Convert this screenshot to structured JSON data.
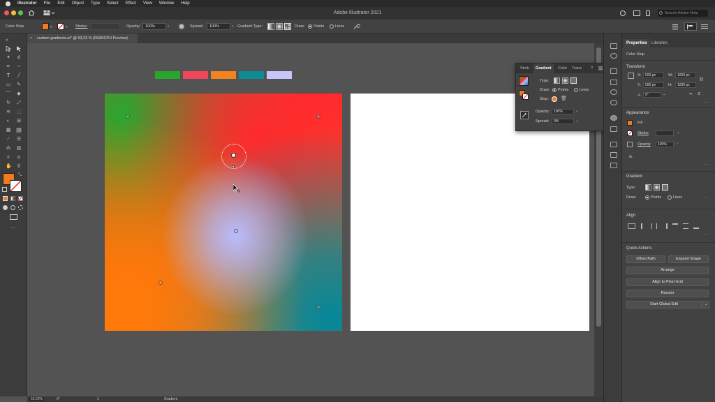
{
  "menubar": {
    "app": "Illustrator",
    "items": [
      "File",
      "Edit",
      "Object",
      "Type",
      "Select",
      "Effect",
      "View",
      "Window",
      "Help"
    ]
  },
  "titlebar": {
    "title": "Adobe Illustrator 2021",
    "search_placeholder": "Search Adobe Help"
  },
  "controlbar": {
    "context": "Color Stop",
    "stroke_label": "Stroke:",
    "opacity_label": "Opacity:",
    "opacity_value": "100%",
    "spread_label": "Spread:",
    "spread_value": "100%",
    "gradient_type_label": "Gradient Type:",
    "draw_label": "Draw:",
    "points_label": "Points",
    "lines_label": "Lines",
    "fill_color": "#f47a20"
  },
  "document": {
    "tab_title": "custom gradients.ai* @ 53,23 % (RGB/CPU Preview)"
  },
  "canvas": {
    "swatch_colors": [
      "#2aa52c",
      "#f0475a",
      "#f4821e",
      "#0e8c96",
      "#c7c6f8"
    ],
    "gradient": {
      "top_left": "#27a82e",
      "top_right": "#ff2a2e",
      "center": "#b8bcff",
      "bottom_left": "#ff7a0a",
      "bottom_right": "#04879a"
    }
  },
  "gradient_panel": {
    "tabs": [
      "Strok",
      "Gradient",
      "Color",
      "Trans"
    ],
    "active_tab": "Gradient",
    "type_label": "Type:",
    "draw_label": "Draw:",
    "points_label": "Points",
    "lines_label": "Lines",
    "stop_label": "Stop:",
    "opacity_label": "Opacity:",
    "opacity_value": "100%",
    "spread_label": "Spread:",
    "spread_value": "0%"
  },
  "properties": {
    "tabs": [
      "Properties",
      "Libraries"
    ],
    "context": "Color Stop",
    "transform": {
      "title": "Transform",
      "x_label": "X:",
      "x_value": "500 px",
      "y_label": "Y:",
      "y_value": "500 px",
      "w_label": "W:",
      "w_value": "1000 px",
      "h_label": "H:",
      "h_value": "1000 px",
      "angle_value": "0°"
    },
    "appearance": {
      "title": "Appearance",
      "fill_label": "Fill",
      "stroke_label": "Stroke",
      "opacity_label": "Opacity",
      "opacity_value": "100%",
      "fx_label": "fx."
    },
    "gradient": {
      "title": "Gradient",
      "type_label": "Type:",
      "draw_label": "Draw:",
      "points_label": "Points",
      "lines_label": "Lines"
    },
    "align": {
      "title": "Align"
    },
    "quick_actions": {
      "title": "Quick Actions",
      "offset_path": "Offset Path",
      "expand_shape": "Expand Shape",
      "arrange": "Arrange",
      "align_pixel_grid": "Align to Pixel Grid",
      "recolor": "Recolor",
      "start_global_edit": "Start Global Edit"
    }
  },
  "statusbar": {
    "zoom": "53,23%",
    "angle": "0°",
    "artboard_num": "1",
    "tool": "Gradient"
  }
}
